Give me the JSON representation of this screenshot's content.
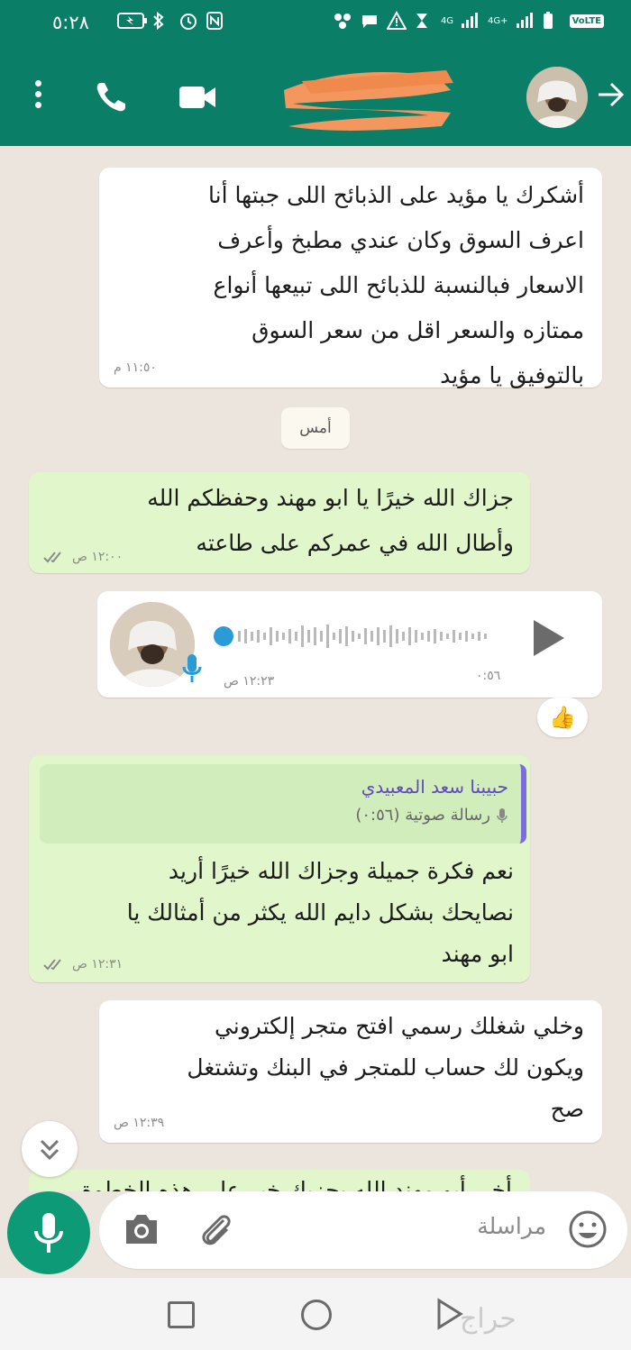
{
  "status_bar": {
    "time": "٥:٢٨",
    "network_1": "4G",
    "network_2": "4G+",
    "volte": "VoLTE"
  },
  "header": {
    "contact_name_redacted": true,
    "icons": [
      "menu-dots-icon",
      "phone-call-icon",
      "video-call-icon",
      "back-arrow-icon"
    ]
  },
  "messages": [
    {
      "direction": "incoming",
      "lines": [
        "أشكرك يا مؤيد على الذبائح اللى جبتها أنا",
        "اعرف السوق وكان عندي مطبخ وأعرف",
        "الاسعار فبالنسبة للذبائح اللى تبيعها أنواع",
        "ممتازه والسعر اقل من سعر السوق",
        "بالتوفيق يا مؤيد"
      ],
      "time": "١١:٥٠ م"
    },
    {
      "direction": "outgoing",
      "lines": [
        "جزاك الله خيرًا يا ابو مهند وحفظكم الله",
        "وأطال الله في عمركم على طاعته"
      ],
      "time": "١٢:٠٠ ص"
    },
    {
      "direction": "incoming",
      "type": "voice",
      "duration": "٠:٥٦",
      "time": "١٢:٢٣ ص",
      "reaction": "👍"
    },
    {
      "direction": "outgoing",
      "quote": {
        "name": "حبيبنا سعد المعبيدي",
        "text": "رسالة صوتية (٠:٥٦)"
      },
      "lines": [
        "نعم فكرة جميلة وجزاك الله خيرًا أريد",
        "نصايحك بشكل دايم الله يكثر من أمثالك يا",
        "ابو مهند"
      ],
      "time": "١٢:٣١ ص"
    },
    {
      "direction": "incoming",
      "lines": [
        "وخلي شغلك رسمي افتح متجر إلكتروني",
        "ويكون لك حساب للمتجر في البنك وتشتغل",
        "صح"
      ],
      "time": "١٢:٣٩ ص"
    }
  ],
  "date_separator": "أمس",
  "partial_message": "أخي أبو مهند الله يجزيك خير على هذه الخطوة",
  "compose": {
    "placeholder": "مراسلة"
  },
  "watermark": "حراج"
}
